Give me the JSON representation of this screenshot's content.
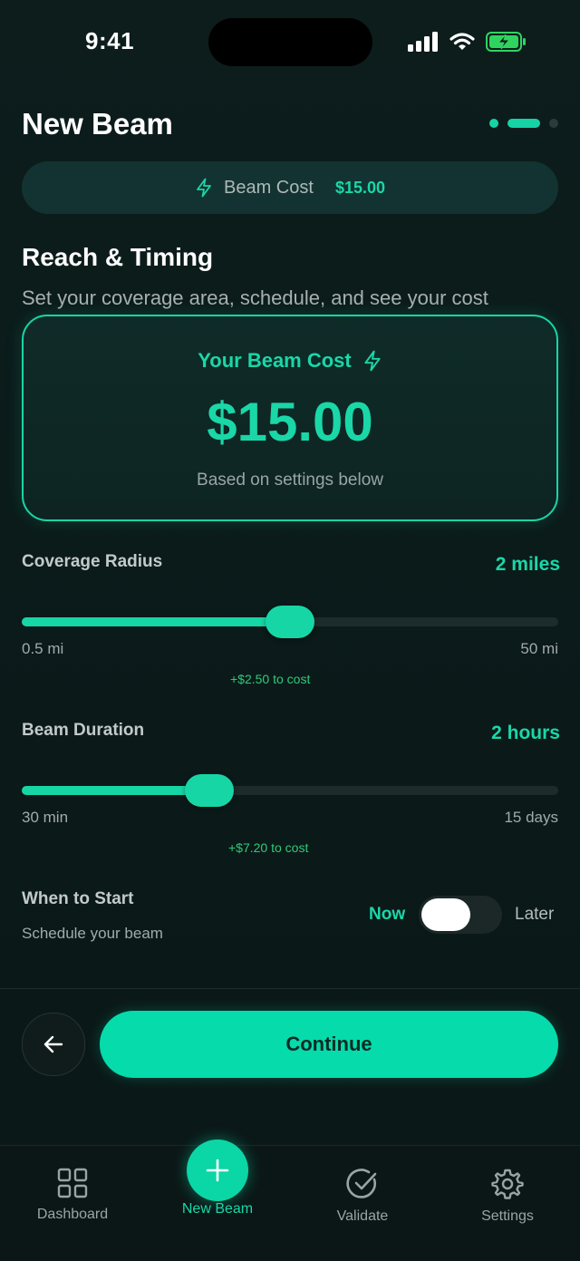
{
  "status_bar": {
    "time": "9:41"
  },
  "header": {
    "title": "New Beam",
    "banner_label": "Beam Cost",
    "banner_value": "$15.00"
  },
  "section": {
    "title": "Reach & Timing",
    "subtitle": "Set your coverage area, schedule, and see your cost"
  },
  "cost_card": {
    "heading": "Your Beam Cost",
    "amount": "$15.00",
    "note": "Based on settings below"
  },
  "radius": {
    "label": "Coverage Radius",
    "value": "2 miles",
    "min_label": "0.5 mi",
    "max_label": "50 mi",
    "level": 0.5,
    "delta": "+$2.50 to cost"
  },
  "duration": {
    "label": "Beam Duration",
    "value": "2 hours",
    "min_label": "30 min",
    "max_label": "15 days",
    "level": 0.35,
    "delta": "+$7.20 to cost"
  },
  "start": {
    "label": "When to Start",
    "sublabel": "Schedule your beam",
    "now_label": "Now",
    "later_label": "Later",
    "selected": "Now"
  },
  "actions": {
    "continue_label": "Continue"
  },
  "tabs": [
    {
      "label": "Dashboard",
      "icon": "grid-icon"
    },
    {
      "label": "New Beam",
      "icon": "plus-icon",
      "active": true
    },
    {
      "label": "Validate",
      "icon": "check-circle-icon"
    },
    {
      "label": "Settings",
      "icon": "gear-icon"
    }
  ],
  "colors": {
    "accent": "#1ad7a8",
    "background": "#0b1a19"
  }
}
